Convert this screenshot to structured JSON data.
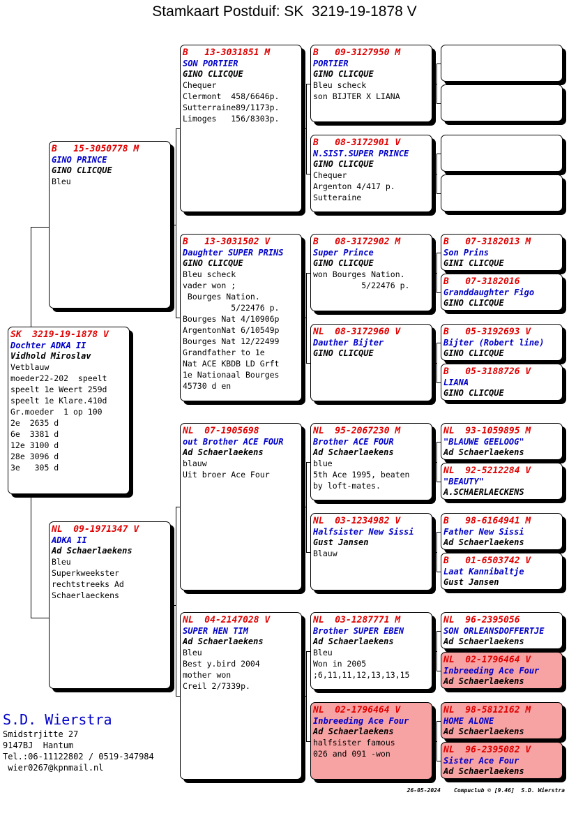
{
  "title": "Stamkaart Postduif: SK  3219-19-1878 V",
  "cards": {
    "root": {
      "ring": "SK  3219-19-1878 V",
      "name": "Dochter ADKA II",
      "breeder": "Vidhold Miroslav",
      "notes": [
        "Vetblauw",
        "moeder22-202  speelt",
        "speelt 1e Weert 259d",
        "speelt 1e Klare.410d",
        "Gr.moeder  1 op 100",
        "2e  2635 d",
        "6e  3381 d",
        "12e 3100 d",
        "28e 3096 d",
        "3e   305 d"
      ]
    },
    "f": {
      "ring": "B   15-3050778 M",
      "name": "GINO PRINCE",
      "breeder": "GINO CLICQUE",
      "notes": [
        "Bleu"
      ]
    },
    "m": {
      "ring": "NL  09-1971347 V",
      "name": "ADKA II",
      "breeder": "Ad Schaerlaekens",
      "notes": [
        "Bleu",
        "Superkweekster",
        "rechtstreeks Ad",
        "Schaerlaeckens"
      ]
    },
    "ff": {
      "ring": "B   13-3031851 M",
      "name": "SON PORTIER",
      "breeder": "GINO CLICQUE",
      "notes": [
        "Chequer",
        "Clermont  458/6646p.",
        "Sutterraine89/1173p.",
        "Limoges   156/8303p."
      ]
    },
    "fm": {
      "ring": "B   13-3031502 V",
      "name": "Daughter SUPER PRINS",
      "breeder": "GINO CLICQUE",
      "notes": [
        "Bleu scheck",
        "vader won ;",
        " Bourges Nation.",
        "          5/22476 p.",
        "Bourges Nat 4/10906p",
        "ArgentonNat 6/10549p",
        "Bourges Nat 12/22499",
        "Grandfather to 1e",
        "Nat ACE KBDB LD Grft",
        "1e Nationaal Bourges",
        "45730 d en"
      ]
    },
    "mf": {
      "ring": "NL  07-1905698",
      "name": "out Brother ACE FOUR",
      "breeder": "Ad Schaerlaekens",
      "notes": [
        "blauw",
        "Uit broer Ace Four"
      ]
    },
    "mm": {
      "ring": "NL  04-2147028 V",
      "name": "SUPER HEN TIM",
      "breeder": "Ad Schaerlaekens",
      "notes": [
        "Bleu",
        "Best y.bird 2004",
        "mother won",
        "Creil 2/7339p."
      ]
    },
    "fff": {
      "ring": "B   09-3127950 M",
      "name": "PORTIER",
      "breeder": "GINO CLICQUE",
      "notes": [
        "Bleu scheck",
        "son BIJTER X LIANA"
      ]
    },
    "ffm": {
      "ring": "B   08-3172901 V",
      "name": "N.SIST.SUPER PRINCE",
      "breeder": "GINO CLICQUE",
      "notes": [
        "Chequer",
        "Argenton 4/417 p.",
        "Sutteraine"
      ]
    },
    "fmf": {
      "ring": "B   08-3172902 M",
      "name": "Super Prince",
      "breeder": "GINO CLICQUE",
      "notes": [
        "",
        "won Bourges Nation.",
        "          5/22476 p."
      ]
    },
    "fmm": {
      "ring": "NL  08-3172960 V",
      "name": "Dauther Bijter",
      "breeder": "GINO CLICQUE",
      "notes": []
    },
    "mff": {
      "ring": "NL  95-2067230 M",
      "name": "Brother ACE FOUR",
      "breeder": "Ad Schaerlaekens",
      "notes": [
        "blue",
        "5th Ace 1995, beaten",
        "by loft-mates."
      ]
    },
    "mfm": {
      "ring": "NL  03-1234982 V",
      "name": "Halfsister New Sissi",
      "breeder": "Gust Jansen",
      "notes": [
        "Blauw"
      ]
    },
    "mmf": {
      "ring": "NL  03-1287771 M",
      "name": "Brother SUPER EBEN",
      "breeder": "Ad Schaerlaekens",
      "notes": [
        "Bleu",
        "Won in 2005",
        ";6,11,11,12,13,13,15"
      ]
    },
    "mmm": {
      "ring": "NL  02-1796464 V",
      "name": "Inbreeding Ace Four",
      "breeder": "Ad Schaerlaekens",
      "notes": [
        "",
        "halfsister famous",
        "026 and 091 -won"
      ]
    },
    "ffff": {
      "ring": "",
      "name": "",
      "breeder": "",
      "notes": []
    },
    "fffm": {
      "ring": "",
      "name": "",
      "breeder": "",
      "notes": []
    },
    "ffmf": {
      "ring": "",
      "name": "",
      "breeder": "",
      "notes": []
    },
    "ffmm": {
      "ring": "",
      "name": "",
      "breeder": "",
      "notes": []
    },
    "fmff": {
      "ring": "B   07-3182013 M",
      "name": "Son Prins",
      "breeder": "GINI CLICQUE",
      "notes": []
    },
    "fmfm": {
      "ring": "B   07-3182016",
      "name": "Granddaughter Figo",
      "breeder": "GINO CLICQUE",
      "notes": []
    },
    "fmmf": {
      "ring": "B   05-3192693 V",
      "name": "Bijter (Robert line)",
      "breeder": "GINO CLICQUE",
      "notes": []
    },
    "fmmm": {
      "ring": "B   05-3188726 V",
      "name": "LIANA",
      "breeder": "GINO CLICQUE",
      "notes": []
    },
    "mfff": {
      "ring": "NL  93-1059895 M",
      "name": "\"BLAUWE GEELOOG\"",
      "breeder": "Ad Schaerlaekens",
      "notes": []
    },
    "mffm": {
      "ring": "NL  92-5212284 V",
      "name": "\"BEAUTY\"",
      "breeder": "A.SCHAERLAECKENS",
      "notes": []
    },
    "mfmf": {
      "ring": "B   98-6164941 M",
      "name": "Father New Sissi",
      "breeder": "Ad Schaerlaekens",
      "notes": []
    },
    "mfmm": {
      "ring": "B   01-6503742 V",
      "name": "Laat Kannibaltje",
      "breeder": "Gust Jansen",
      "notes": []
    },
    "mmff": {
      "ring": "NL  96-2395056",
      "name": "SON ORLEANSDOFFERTJE",
      "breeder": "Ad Schaerlaekens",
      "notes": []
    },
    "mmfm": {
      "ring": "NL  02-1796464 V",
      "name": "Inbreeding Ace Four",
      "breeder": "Ad Schaerlaekens",
      "notes": []
    },
    "mmmf": {
      "ring": "NL  98-5812162 M",
      "name": "HOME ALONE",
      "breeder": "Ad Schaerlaekens",
      "notes": []
    },
    "mmmm": {
      "ring": "NL  96-2395082 V",
      "name": "Sister Ace Four",
      "breeder": "Ad Schaerlaekens",
      "notes": []
    }
  },
  "breeder": {
    "name": "S.D. Wierstra",
    "address": "Smidstrjitte 27",
    "city": "9147BJ  Hantum",
    "tel": "Tel.:06-11122802 / 0519-347984",
    "email": " wier0267@kpnmail.nl"
  },
  "footer": "26-05-2024    Compuclub © [9.46]  S.D. Wierstra",
  "colors": {
    "ring": "#e00000",
    "name": "#0000c8",
    "highlight": "#f7a3a3"
  }
}
